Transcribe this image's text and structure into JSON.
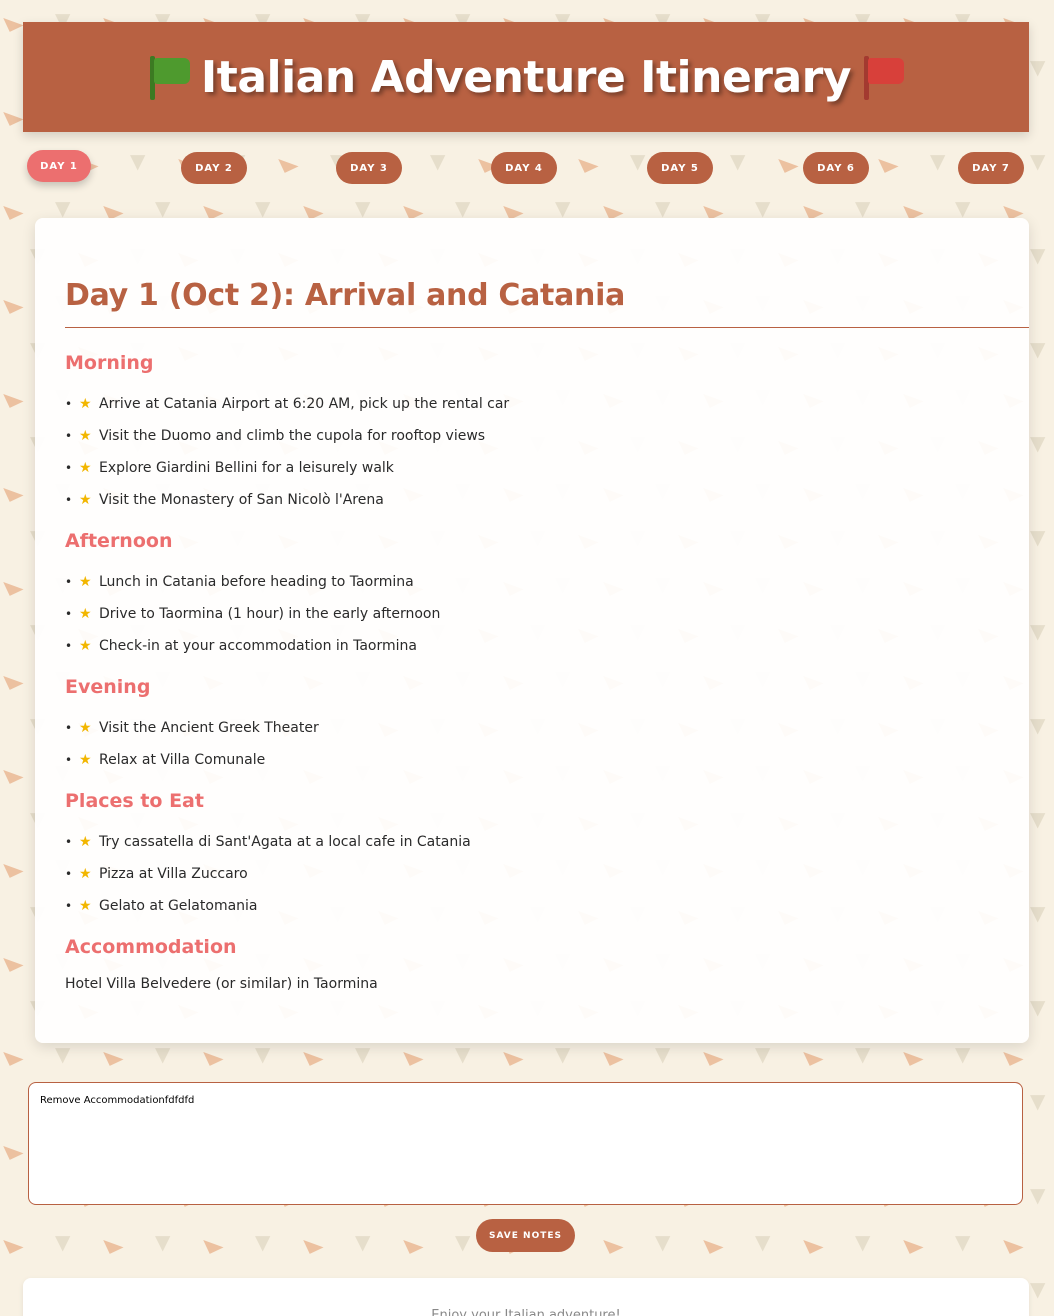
{
  "header": {
    "title": "Italian Adventure Itinerary",
    "left_icon": "green-flag-icon",
    "right_icon": "red-flag-icon"
  },
  "tabs": [
    {
      "label": "DAY 1",
      "active": true
    },
    {
      "label": "DAY 2",
      "active": false
    },
    {
      "label": "DAY 3",
      "active": false
    },
    {
      "label": "DAY 4",
      "active": false
    },
    {
      "label": "DAY 5",
      "active": false
    },
    {
      "label": "DAY 6",
      "active": false
    },
    {
      "label": "DAY 7",
      "active": false
    }
  ],
  "day": {
    "title": "Day 1 (Oct 2): Arrival and Catania",
    "morning": {
      "heading": "Morning",
      "items": [
        "Arrive at Catania Airport at 6:20 AM, pick up the rental car",
        "Visit the Duomo and climb the cupola for rooftop views",
        "Explore Giardini Bellini for a leisurely walk",
        "Visit the Monastery of San Nicolò l'Arena"
      ]
    },
    "afternoon": {
      "heading": "Afternoon",
      "items": [
        "Lunch in Catania before heading to Taormina",
        "Drive to Taormina (1 hour) in the early afternoon",
        "Check-in at your accommodation in Taormina"
      ]
    },
    "evening": {
      "heading": "Evening",
      "items": [
        "Visit the Ancient Greek Theater",
        "Relax at Villa Comunale"
      ]
    },
    "eat": {
      "heading": "Places to Eat",
      "items": [
        "Try cassatella di Sant'Agata at a local cafe in Catania",
        "Pizza at Villa Zuccaro",
        "Gelato at Gelatomania"
      ]
    },
    "accommodation": {
      "heading": "Accommodation",
      "text": "Hotel Villa Belvedere (or similar) in Taormina"
    }
  },
  "notes": {
    "value": "Remove Accommodationfdfdfd"
  },
  "save_button": "SAVE NOTES",
  "footer": {
    "text": "Enjoy your Italian adventure!"
  },
  "colors": {
    "brand": "#b86142",
    "accent": "#ec6f6f",
    "background": "#f8f1e3"
  }
}
